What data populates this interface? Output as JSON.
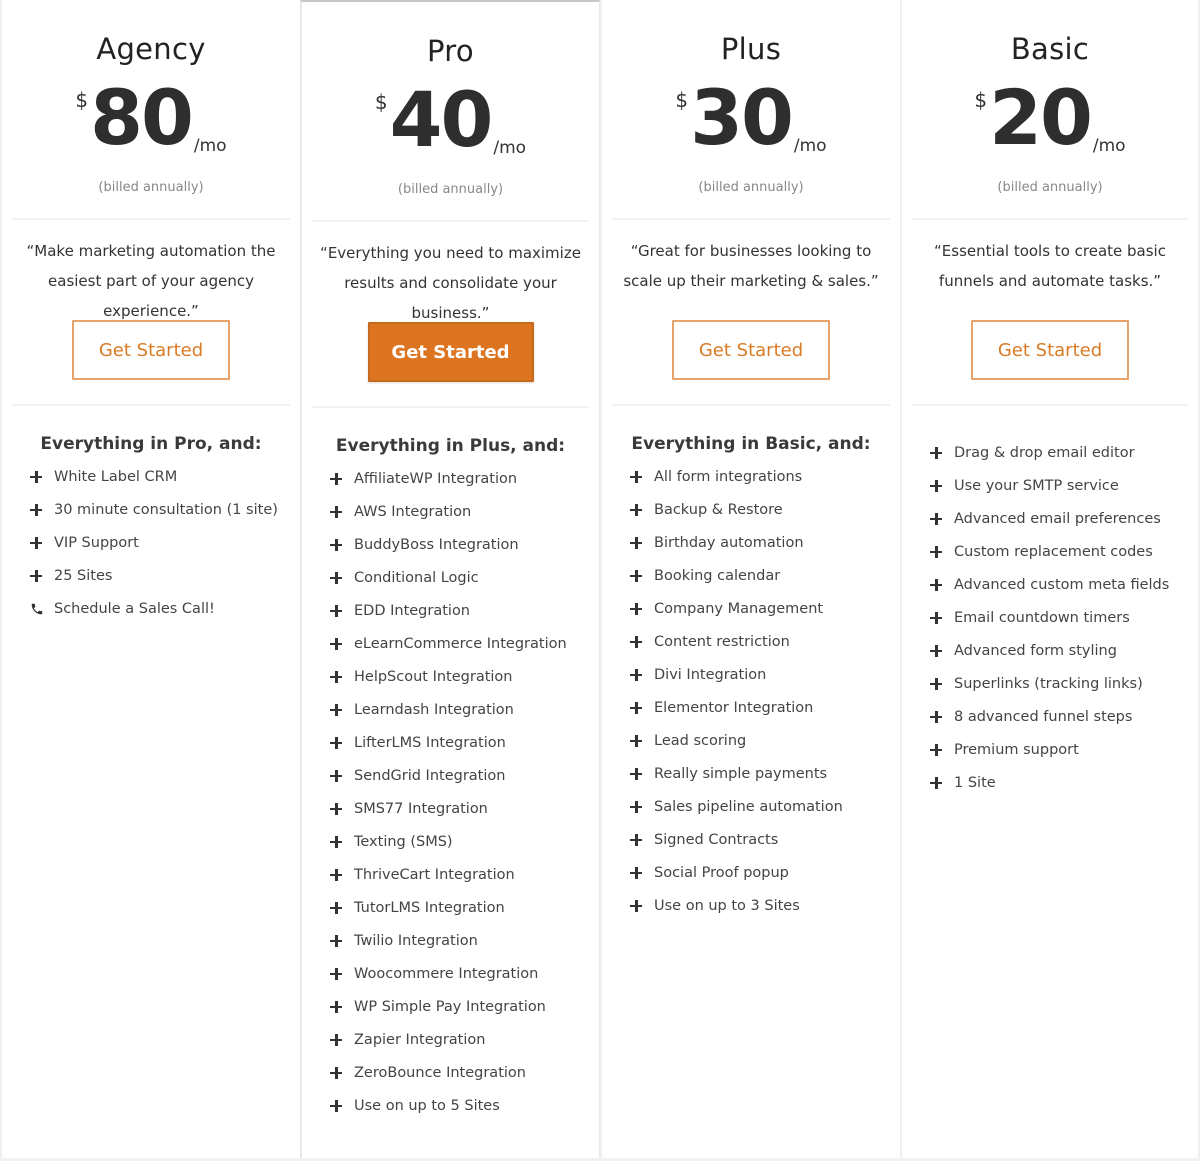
{
  "colors": {
    "accent": "#dd7420",
    "accent_text": "#d97b25",
    "text": "#333333",
    "muted": "#888888"
  },
  "plans": [
    {
      "name": "Agency",
      "currency": "$",
      "amount": "80",
      "period": "/mo",
      "billing": "(billed annually)",
      "quote": "“Make marketing automation the easiest part of your agency experience.”",
      "button": "Get Started",
      "featured": false,
      "features_title": "Everything in Pro, and:",
      "features": [
        {
          "icon": "plus-icon",
          "label": "White Label CRM"
        },
        {
          "icon": "plus-icon",
          "label": "30 minute consultation (1 site)"
        },
        {
          "icon": "plus-icon",
          "label": "VIP Support"
        },
        {
          "icon": "plus-icon",
          "label": "25 Sites"
        },
        {
          "icon": "phone-icon",
          "label": "Schedule a Sales Call!"
        }
      ]
    },
    {
      "name": "Pro",
      "currency": "$",
      "amount": "40",
      "period": "/mo",
      "billing": "(billed annually)",
      "quote": "“Everything you need to maximize results and consolidate your business.”",
      "button": "Get Started",
      "featured": true,
      "features_title": "Everything in Plus, and:",
      "features": [
        {
          "icon": "plus-icon",
          "label": "AffiliateWP Integration"
        },
        {
          "icon": "plus-icon",
          "label": "AWS Integration"
        },
        {
          "icon": "plus-icon",
          "label": "BuddyBoss Integration"
        },
        {
          "icon": "plus-icon",
          "label": "Conditional Logic"
        },
        {
          "icon": "plus-icon",
          "label": "EDD Integration"
        },
        {
          "icon": "plus-icon",
          "label": "eLearnCommerce Integration"
        },
        {
          "icon": "plus-icon",
          "label": "HelpScout Integration"
        },
        {
          "icon": "plus-icon",
          "label": "Learndash Integration"
        },
        {
          "icon": "plus-icon",
          "label": "LifterLMS Integration"
        },
        {
          "icon": "plus-icon",
          "label": "SendGrid Integration"
        },
        {
          "icon": "plus-icon",
          "label": "SMS77 Integration"
        },
        {
          "icon": "plus-icon",
          "label": "Texting (SMS)"
        },
        {
          "icon": "plus-icon",
          "label": "ThriveCart Integration"
        },
        {
          "icon": "plus-icon",
          "label": "TutorLMS Integration"
        },
        {
          "icon": "plus-icon",
          "label": "Twilio Integration"
        },
        {
          "icon": "plus-icon",
          "label": "Woocommere Integration"
        },
        {
          "icon": "plus-icon",
          "label": "WP Simple Pay Integration"
        },
        {
          "icon": "plus-icon",
          "label": "Zapier Integration"
        },
        {
          "icon": "plus-icon",
          "label": "ZeroBounce Integration"
        },
        {
          "icon": "plus-icon",
          "label": "Use on up to 5 Sites"
        }
      ]
    },
    {
      "name": "Plus",
      "currency": "$",
      "amount": "30",
      "period": "/mo",
      "billing": "(billed annually)",
      "quote": "“Great for businesses looking to scale up their marketing & sales.”",
      "button": "Get Started",
      "featured": false,
      "features_title": "Everything in Basic, and:",
      "features": [
        {
          "icon": "plus-icon",
          "label": "All form integrations"
        },
        {
          "icon": "plus-icon",
          "label": "Backup & Restore"
        },
        {
          "icon": "plus-icon",
          "label": "Birthday automation"
        },
        {
          "icon": "plus-icon",
          "label": "Booking calendar"
        },
        {
          "icon": "plus-icon",
          "label": "Company Management"
        },
        {
          "icon": "plus-icon",
          "label": "Content restriction"
        },
        {
          "icon": "plus-icon",
          "label": "Divi Integration"
        },
        {
          "icon": "plus-icon",
          "label": "Elementor Integration"
        },
        {
          "icon": "plus-icon",
          "label": "Lead scoring"
        },
        {
          "icon": "plus-icon",
          "label": "Really simple payments"
        },
        {
          "icon": "plus-icon",
          "label": "Sales pipeline automation"
        },
        {
          "icon": "plus-icon",
          "label": "Signed Contracts"
        },
        {
          "icon": "plus-icon",
          "label": "Social Proof popup"
        },
        {
          "icon": "plus-icon",
          "label": "Use on up to 3 Sites"
        }
      ]
    },
    {
      "name": "Basic",
      "currency": "$",
      "amount": "20",
      "period": "/mo",
      "billing": "(billed annually)",
      "quote": "“Essential tools to create basic funnels and automate tasks.”",
      "button": "Get Started",
      "featured": false,
      "features_title": "",
      "features": [
        {
          "icon": "plus-icon",
          "label": "Drag & drop email editor"
        },
        {
          "icon": "plus-icon",
          "label": "Use your SMTP service"
        },
        {
          "icon": "plus-icon",
          "label": "Advanced email preferences"
        },
        {
          "icon": "plus-icon",
          "label": "Custom replacement codes"
        },
        {
          "icon": "plus-icon",
          "label": "Advanced custom meta fields"
        },
        {
          "icon": "plus-icon",
          "label": "Email countdown timers"
        },
        {
          "icon": "plus-icon",
          "label": "Advanced form styling"
        },
        {
          "icon": "plus-icon",
          "label": "Superlinks (tracking links)"
        },
        {
          "icon": "plus-icon",
          "label": "8 advanced funnel steps"
        },
        {
          "icon": "plus-icon",
          "label": "Premium support"
        },
        {
          "icon": "plus-icon",
          "label": "1 Site"
        }
      ]
    }
  ]
}
